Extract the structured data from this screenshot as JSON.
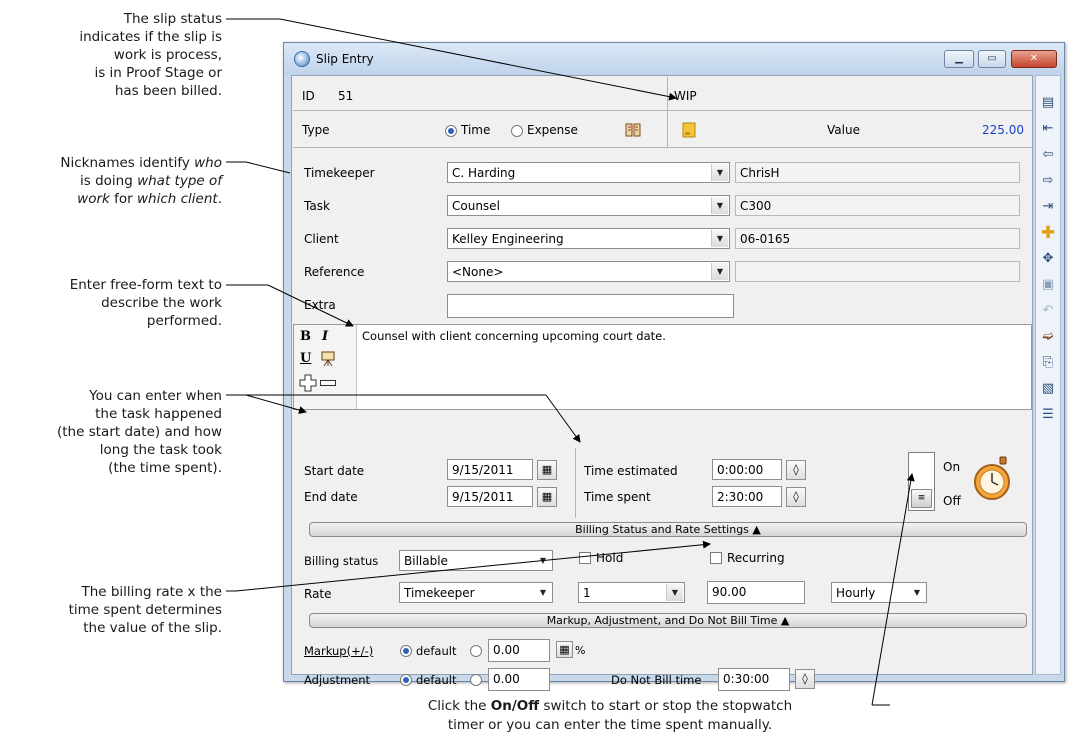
{
  "callouts": {
    "slip_status": "The slip status\nindicates if the slip is\nwork is process,\nis in Proof Stage or\nhas been billed.",
    "nicknames_1": "Nicknames identify ",
    "nicknames_who": "who",
    "nicknames_2": "is doing ",
    "nicknames_what": "what type of",
    "nicknames_work": "work",
    "nicknames_for": " for ",
    "nicknames_client": "which client",
    "nicknames_end": ".",
    "free_form": "Enter free-form text to\ndescribe the work\nperformed.",
    "dates": "You can enter when\nthe task happened\n(the start date) and how\nlong the task took\n(the time spent).",
    "rate": "The billing rate x the\ntime spent determines\nthe value of the slip.",
    "onoff_1": "Click the ",
    "onoff_bold": "On/Off",
    "onoff_2": " switch to start or stop the stopwatch",
    "onoff_3": "timer or you can enter the time spent manually."
  },
  "window": {
    "title": "Slip Entry",
    "minimize": "▁",
    "maximize": "▭",
    "close": "✕"
  },
  "header": {
    "id_label": "ID",
    "id_value": "51",
    "status": "WIP",
    "type_label": "Type",
    "type_time": "Time",
    "type_expense": "Expense",
    "type_selected": "Time",
    "value_label": "Value",
    "value": "225.00"
  },
  "fields": {
    "timekeeper_label": "Timekeeper",
    "timekeeper": "C. Harding",
    "timekeeper_nick": "ChrisH",
    "task_label": "Task",
    "task": "Counsel",
    "task_nick": "C300",
    "client_label": "Client",
    "client": "Kelley Engineering",
    "client_nick": "06-0165",
    "reference_label": "Reference",
    "reference": "<None>",
    "reference_nick": "",
    "extra_label": "Extra",
    "extra": ""
  },
  "notes": {
    "text": "Counsel with client concerning upcoming court date.",
    "bold": "B",
    "italic": "I",
    "underline": "U"
  },
  "dates": {
    "start_label": "Start date",
    "start": "9/15/2011",
    "end_label": "End date",
    "end": "9/15/2011",
    "est_label": "Time estimated",
    "est": "0:00:00",
    "spent_label": "Time spent",
    "spent": "2:30:00",
    "on": "On",
    "off": "Off"
  },
  "billing": {
    "section": "Billing Status and Rate Settings ▲",
    "status_label": "Billing status",
    "status": "Billable",
    "hold": "Hold",
    "recurring": "Recurring",
    "rate_label": "Rate",
    "rate_source": "Timekeeper",
    "rate_level": "1",
    "rate_value": "90.00",
    "rate_unit": "Hourly"
  },
  "markup": {
    "section": "Markup, Adjustment, and Do Not Bill Time ▲",
    "markup_label": "Markup(+/-)",
    "default": "default",
    "markup_value": "0.00",
    "percent": "%",
    "adjust_label": "Adjustment",
    "adjust_value": "0.00",
    "dnb_label": "Do Not Bill time",
    "dnb_value": "0:30:00"
  },
  "toolbar": [
    "page-icon",
    "first-icon",
    "prev-icon",
    "next-icon",
    "last-icon",
    "add-icon",
    "duplicate-icon",
    "save-icon",
    "undo-icon",
    "transfer-icon",
    "preview-icon",
    "report-icon",
    "list-icon"
  ]
}
